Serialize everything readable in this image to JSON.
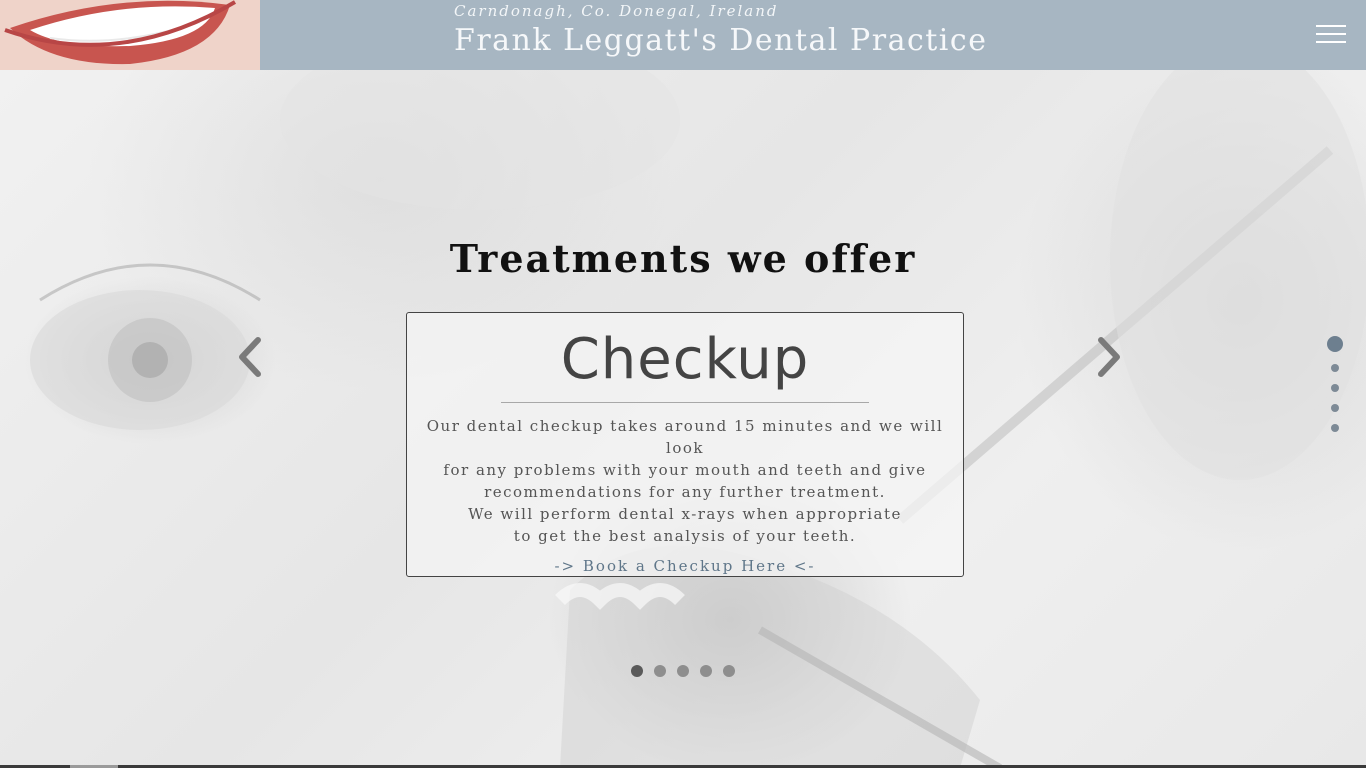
{
  "header": {
    "location": "Carndonagh, Co. Donegal, Ireland",
    "title": "Frank Leggatt's Dental Practice",
    "menu_icon": "hamburger-menu-icon",
    "bg_color": "#a7b6c2"
  },
  "section": {
    "heading": "Treatments we offer"
  },
  "slide": {
    "title": "Checkup",
    "description_lines": [
      "Our dental checkup takes around 15 minutes and we will look",
      "for any problems with your mouth and teeth and give",
      "recommendations for any further treatment.",
      "We will perform dental x-rays when appropriate",
      "to get the best analysis of your teeth."
    ],
    "link": "-> Book a Checkup Here <-",
    "link_color": "#5f7689"
  },
  "carousel": {
    "prev_icon": "chevron-left-icon",
    "next_icon": "chevron-right-icon",
    "slide_count": 5,
    "active_index": 0
  },
  "side_nav": {
    "count": 5,
    "active_index": 0
  }
}
